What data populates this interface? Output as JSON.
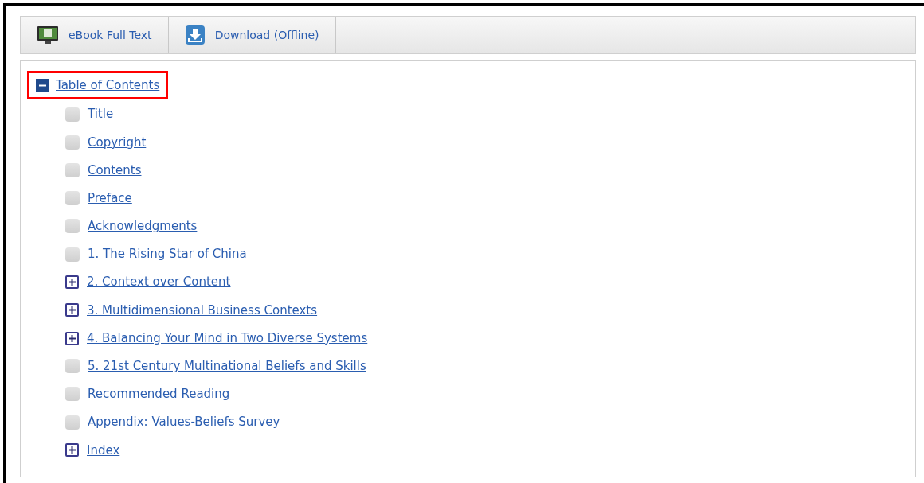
{
  "toolbar": [
    {
      "kind": "ebook",
      "label": "eBook Full Text"
    },
    {
      "kind": "download",
      "label": "Download (Offline)"
    }
  ],
  "toc": {
    "label": "Table of Contents",
    "expanded": true,
    "highlighted": true,
    "children": [
      {
        "label": "Title",
        "kind": "leaf"
      },
      {
        "label": "Copyright",
        "kind": "leaf"
      },
      {
        "label": "Contents",
        "kind": "leaf"
      },
      {
        "label": "Preface",
        "kind": "leaf"
      },
      {
        "label": "Acknowledgments",
        "kind": "leaf"
      },
      {
        "label": "1. The Rising Star of China",
        "kind": "leaf"
      },
      {
        "label": "2. Context over Content",
        "kind": "node",
        "expanded": false
      },
      {
        "label": "3. Multidimensional Business Contexts",
        "kind": "node",
        "expanded": false
      },
      {
        "label": "4. Balancing Your Mind in Two Diverse Systems",
        "kind": "node",
        "expanded": false
      },
      {
        "label": "5. 21st Century Multinational Beliefs and Skills",
        "kind": "leaf"
      },
      {
        "label": "Recommended Reading",
        "kind": "leaf"
      },
      {
        "label": "Appendix: Values-Beliefs Survey",
        "kind": "leaf"
      },
      {
        "label": "Index",
        "kind": "node",
        "expanded": false
      }
    ]
  }
}
